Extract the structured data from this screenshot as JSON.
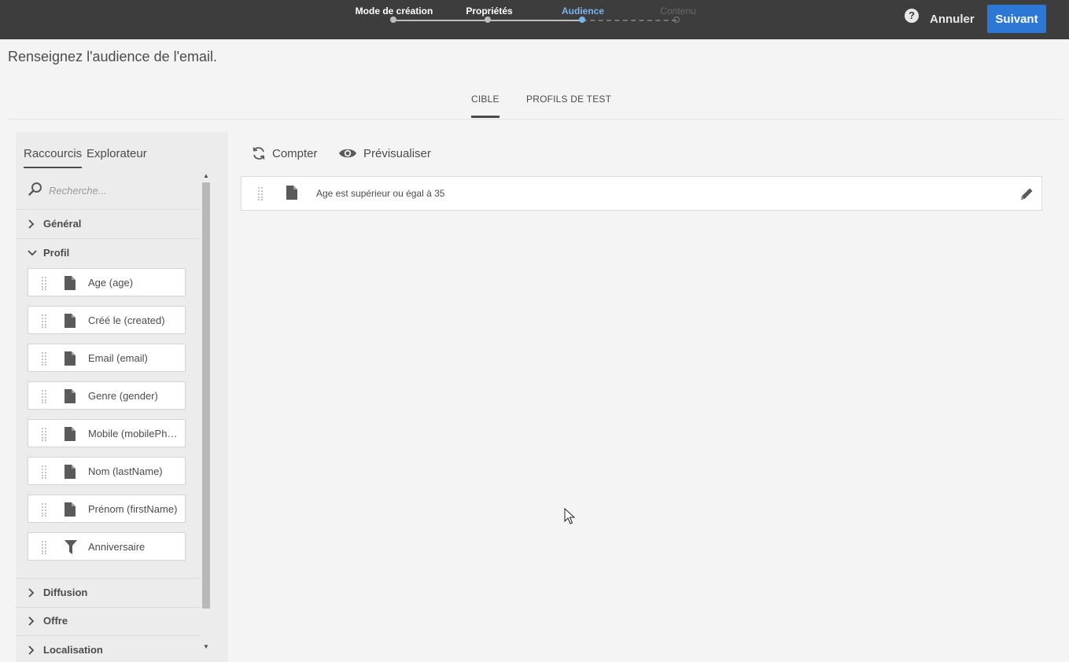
{
  "header": {
    "steps": [
      {
        "label": "Mode de création",
        "state": "done"
      },
      {
        "label": "Propriétés",
        "state": "done"
      },
      {
        "label": "Audience",
        "state": "active"
      },
      {
        "label": "Contenu",
        "state": "future"
      }
    ],
    "help_icon": "question-circle-icon",
    "cancel_label": "Annuler",
    "next_label": "Suivant"
  },
  "page_title": "Renseignez l'audience de l'email.",
  "tabs": [
    {
      "label": "CIBLE",
      "active": true
    },
    {
      "label": "PROFILS DE TEST",
      "active": false
    }
  ],
  "left_panel": {
    "tabs": [
      {
        "label": "Raccourcis",
        "active": true
      },
      {
        "label": "Explorateur",
        "active": false
      }
    ],
    "search": {
      "placeholder": "Recherche...",
      "value": ""
    },
    "sections": [
      {
        "label": "Général",
        "expanded": false
      },
      {
        "label": "Profil",
        "expanded": true
      },
      {
        "label": "Diffusion",
        "expanded": false
      },
      {
        "label": "Offre",
        "expanded": false
      },
      {
        "label": "Localisation",
        "expanded": false
      }
    ],
    "profil_items": [
      {
        "label": "Age (age)",
        "icon": "file-icon"
      },
      {
        "label": "Créé le (created)",
        "icon": "file-icon"
      },
      {
        "label": "Email (email)",
        "icon": "file-icon"
      },
      {
        "label": "Genre (gender)",
        "icon": "file-icon"
      },
      {
        "label": "Mobile (mobilePho...",
        "icon": "file-icon"
      },
      {
        "label": "Nom (lastName)",
        "icon": "file-icon"
      },
      {
        "label": "Prénom (firstName)",
        "icon": "file-icon"
      },
      {
        "label": "Anniversaire",
        "icon": "filter-icon"
      }
    ]
  },
  "toolbar": {
    "count_label": "Compter",
    "preview_label": "Prévisualiser"
  },
  "rules": [
    {
      "label": "Age est supérieur ou égal à 35",
      "icon": "file-icon"
    }
  ],
  "colors": {
    "topbar": "#3d3d3d",
    "accent": "#2d77d6",
    "active_step": "#7ab4ee",
    "background": "#f4f4f4"
  }
}
